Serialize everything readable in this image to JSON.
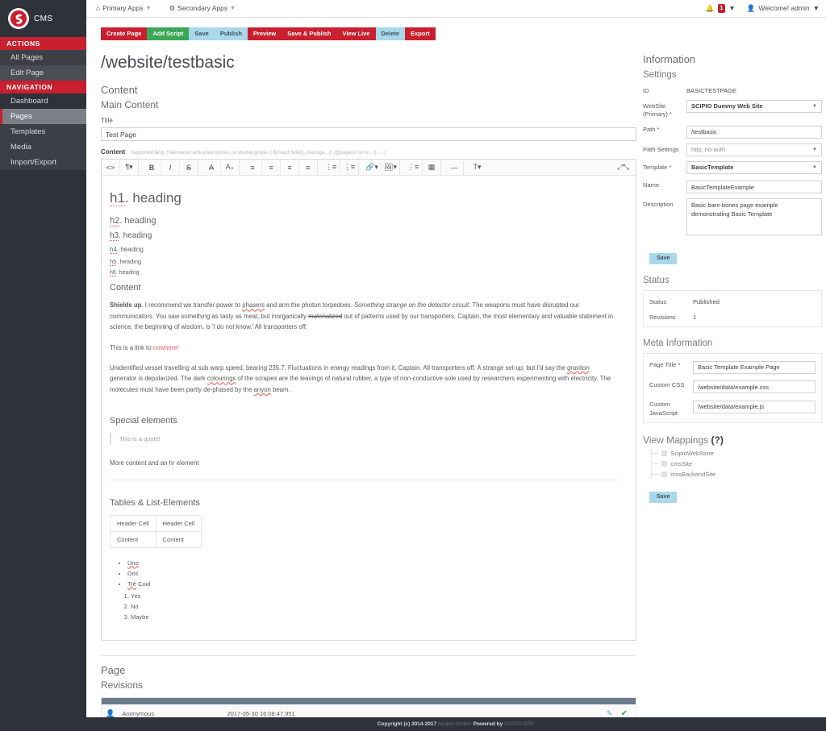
{
  "brand": {
    "name": "CMS",
    "logo_icon": "scipio-logo-icon"
  },
  "sidebar": {
    "sections": [
      {
        "title": "ACTIONS",
        "items": [
          {
            "label": "All Pages",
            "state": "normal"
          },
          {
            "label": "Edit Page",
            "state": "semi"
          }
        ]
      },
      {
        "title": "NAVIGATION",
        "items": [
          {
            "label": "Dashboard",
            "state": "dark"
          },
          {
            "label": "Pages",
            "state": "active"
          },
          {
            "label": "Templates",
            "state": "normal"
          },
          {
            "label": "Media",
            "state": "normal"
          },
          {
            "label": "Import/Export",
            "state": "normal"
          }
        ]
      }
    ]
  },
  "topbar": {
    "primary_apps": "Primary Apps",
    "secondary_apps": "Secondary Apps",
    "notification_count": "1",
    "welcome": "Welcome! admin"
  },
  "actions": [
    {
      "label": "Create Page",
      "style": "red"
    },
    {
      "label": "Add Script",
      "style": "green"
    },
    {
      "label": "Save",
      "style": "blue"
    },
    {
      "label": "Publish",
      "style": "blue"
    },
    {
      "label": "Preview",
      "style": "red"
    },
    {
      "label": "Save & Publish",
      "style": "red"
    },
    {
      "label": "View Live",
      "style": "red"
    },
    {
      "label": "Delete",
      "style": "blue"
    },
    {
      "label": "Export",
      "style": "red"
    }
  ],
  "page": {
    "path_title": "/website/testbasic",
    "content_heading": "Content",
    "main_content_heading": "Main Content",
    "title_label": "Title",
    "title_value": "Test Page",
    "content_label": "Content",
    "content_hint": "Supported lang: Freemarker w/bracket syntax, no double quotes ( ${map1.field1}, [#assign.../], [@pageUrl id='x'.../], ... )"
  },
  "editor": {
    "toolbar_icons": [
      "source-code-icon",
      "paragraph-format-icon",
      "bold-icon",
      "italic-icon",
      "strikethrough-icon",
      "clear-formatting-icon",
      "subscript-icon",
      "align-left-icon",
      "align-center-icon",
      "align-right-icon",
      "align-justify-icon",
      "unordered-list-icon",
      "ordered-list-icon",
      "link-icon",
      "image-icon",
      "list-icon",
      "table-icon",
      "horizontal-rule-icon",
      "text-color-icon",
      "fullscreen-icon"
    ],
    "headings": [
      {
        "prefix": "h1",
        "rest": ". heading"
      },
      {
        "prefix": "h2",
        "rest": ". heading"
      },
      {
        "prefix": "h3",
        "rest": ". heading"
      },
      {
        "prefix": "h4",
        "rest": ". heading"
      },
      {
        "prefix": "h5",
        "rest": ". heading"
      },
      {
        "prefix": "h6",
        "rest": ". heading"
      }
    ],
    "content_section_title": "Content",
    "para1": {
      "bold": "Shields up",
      "a": ". I recommend we transfer power to ",
      "spell1": "phasers",
      "b": " and arm the photon torpedoes. ",
      "italic": "Something strange on the detector circuit.",
      "c": " The weapons must have disrupted our communicators. You saw something as tasty as meat, but inorganically ",
      "strike": "materialized",
      "d": " out of patterns used by our transporters. Captain, the most elementary and valuable statement in science, the beginning of wisdom, is 'I do not know.' All transporters off."
    },
    "para2": {
      "a": "This is a link to ",
      "link": "nowhere!"
    },
    "para3": {
      "a": "Unidentified vessel travelling at sub warp speed, bearing 235.7. Fluctuations in energy readings from it, Captain. All transporters off. A strange set-up, but I'd say the ",
      "spell1": "graviton",
      "b": " generator is depolarized. The dark ",
      "spell2": "colourings",
      "c": " of the scrapes are the leavings of natural rubber, a type of non-conductive sole used by researchers experimenting with electricity. The molecules must have been partly de-phased by the ",
      "spell3": "anyon",
      "d": " beam."
    },
    "special_title": "Special elements",
    "quote": "This is a quote!",
    "more_content": "More content and an hr element",
    "tables_title": "Tables & List-Elements",
    "table": {
      "headers": [
        "Header Cell",
        "Header Cell"
      ],
      "rows": [
        [
          "Content",
          "Content"
        ]
      ]
    },
    "bullets": [
      {
        "spell": "Uno",
        "rest": ""
      },
      {
        "spell": "",
        "rest": "Dos"
      },
      {
        "spell": "Tré",
        "rest": " Cool"
      }
    ],
    "numbered": [
      "Yes",
      "No",
      "Maybe"
    ]
  },
  "bottom": {
    "page_heading": "Page",
    "revisions_heading": "Revisions",
    "revisions": [
      {
        "user": "Anonymous",
        "date": "2017-05-30 16:08:47.951",
        "edit_icon": "edit-icon",
        "approve_icon": "check-icon"
      }
    ]
  },
  "info": {
    "title": "Information",
    "settings_title": "Settings",
    "id_label": "ID",
    "id_value": "BASICTESTPAGE",
    "website_label": "WebSite (Primary) *",
    "website_value": "SCIPIO Dummy Web Site",
    "path_label": "Path *",
    "path_value": "/testbasic",
    "path_settings_label": "Path Settings",
    "path_settings_value": "http, no-auth",
    "template_label": "Template *",
    "template_value": "BasicTemplate",
    "name_label": "Name",
    "name_value": "BasicTemplateExample",
    "description_label": "Description",
    "description_value": "Basic bare-bones page example demonstrating Basic Template",
    "save_label": "Save",
    "status_title": "Status",
    "status_label": "Status",
    "status_value": "Published",
    "revisions_label": "Revisions",
    "revisions_value": "1",
    "meta_title": "Meta Information",
    "page_title_label": "Page Title *",
    "page_title_value": "Basic Template Example Page",
    "custom_css_label": "Custom CSS",
    "custom_css_value": "/website/data/example.css",
    "custom_js_label": "Custom JavaScript",
    "custom_js_value": "/website/data/example.js",
    "view_mappings_title": "View Mappings",
    "view_mappings_help": "(?)",
    "view_mappings": [
      "ScipioWebStore",
      "cmsSite",
      "cmsBackendSite"
    ],
    "save_label2": "Save"
  },
  "footer": {
    "copyright": "Copyright (c) 2014-2017",
    "company": "ilscipio GmbH.",
    "powered": "Powered by",
    "product": "SCIPIO ERP."
  },
  "colors": {
    "accent_red": "#c8202f",
    "accent_green": "#3aa757",
    "accent_blue": "#a8d8ea",
    "sidebar_dark": "#2f3239"
  }
}
